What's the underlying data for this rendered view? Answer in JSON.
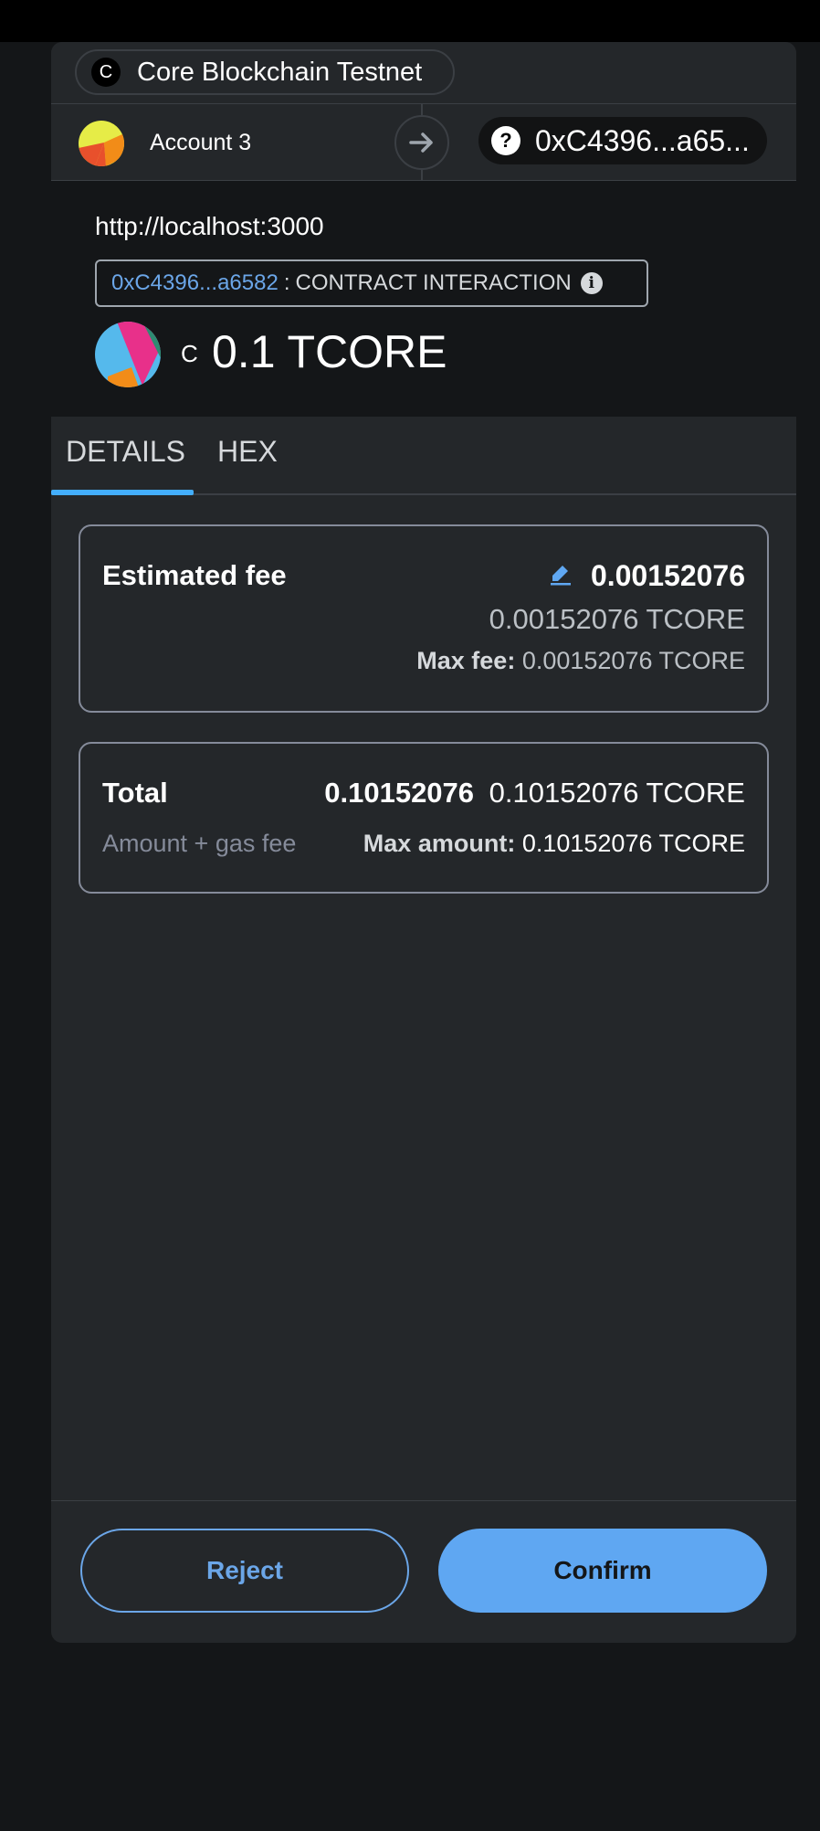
{
  "network": {
    "icon_letter": "C",
    "name": "Core Blockchain Testnet"
  },
  "account": {
    "name": "Account 3",
    "recipient_address": "0xC4396...a65..."
  },
  "transaction": {
    "origin": "http://localhost:3000",
    "contract_address": "0xC4396...a6582",
    "separator": ":",
    "type_label": "CONTRACT INTERACTION",
    "info_icon": "i",
    "currency_symbol": "C",
    "amount": "0.1 TCORE"
  },
  "tabs": [
    {
      "label": "DETAILS",
      "active": true
    },
    {
      "label": "HEX",
      "active": false
    }
  ],
  "fee": {
    "label": "Estimated fee",
    "primary": "0.00152076",
    "secondary": "0.00152076 TCORE",
    "max_label": "Max fee:",
    "max_value": "0.00152076 TCORE"
  },
  "total": {
    "label": "Total",
    "primary": "0.10152076",
    "secondary": "0.10152076 TCORE",
    "sub_label": "Amount + gas fee",
    "max_label": "Max amount:",
    "max_value": "0.10152076 TCORE"
  },
  "buttons": {
    "reject": "Reject",
    "confirm": "Confirm"
  },
  "colors": {
    "accent": "#43aefc",
    "primary_button": "#5fa7f2",
    "link": "#6ba6e8",
    "background": "#141618",
    "panel": "#24272a"
  }
}
